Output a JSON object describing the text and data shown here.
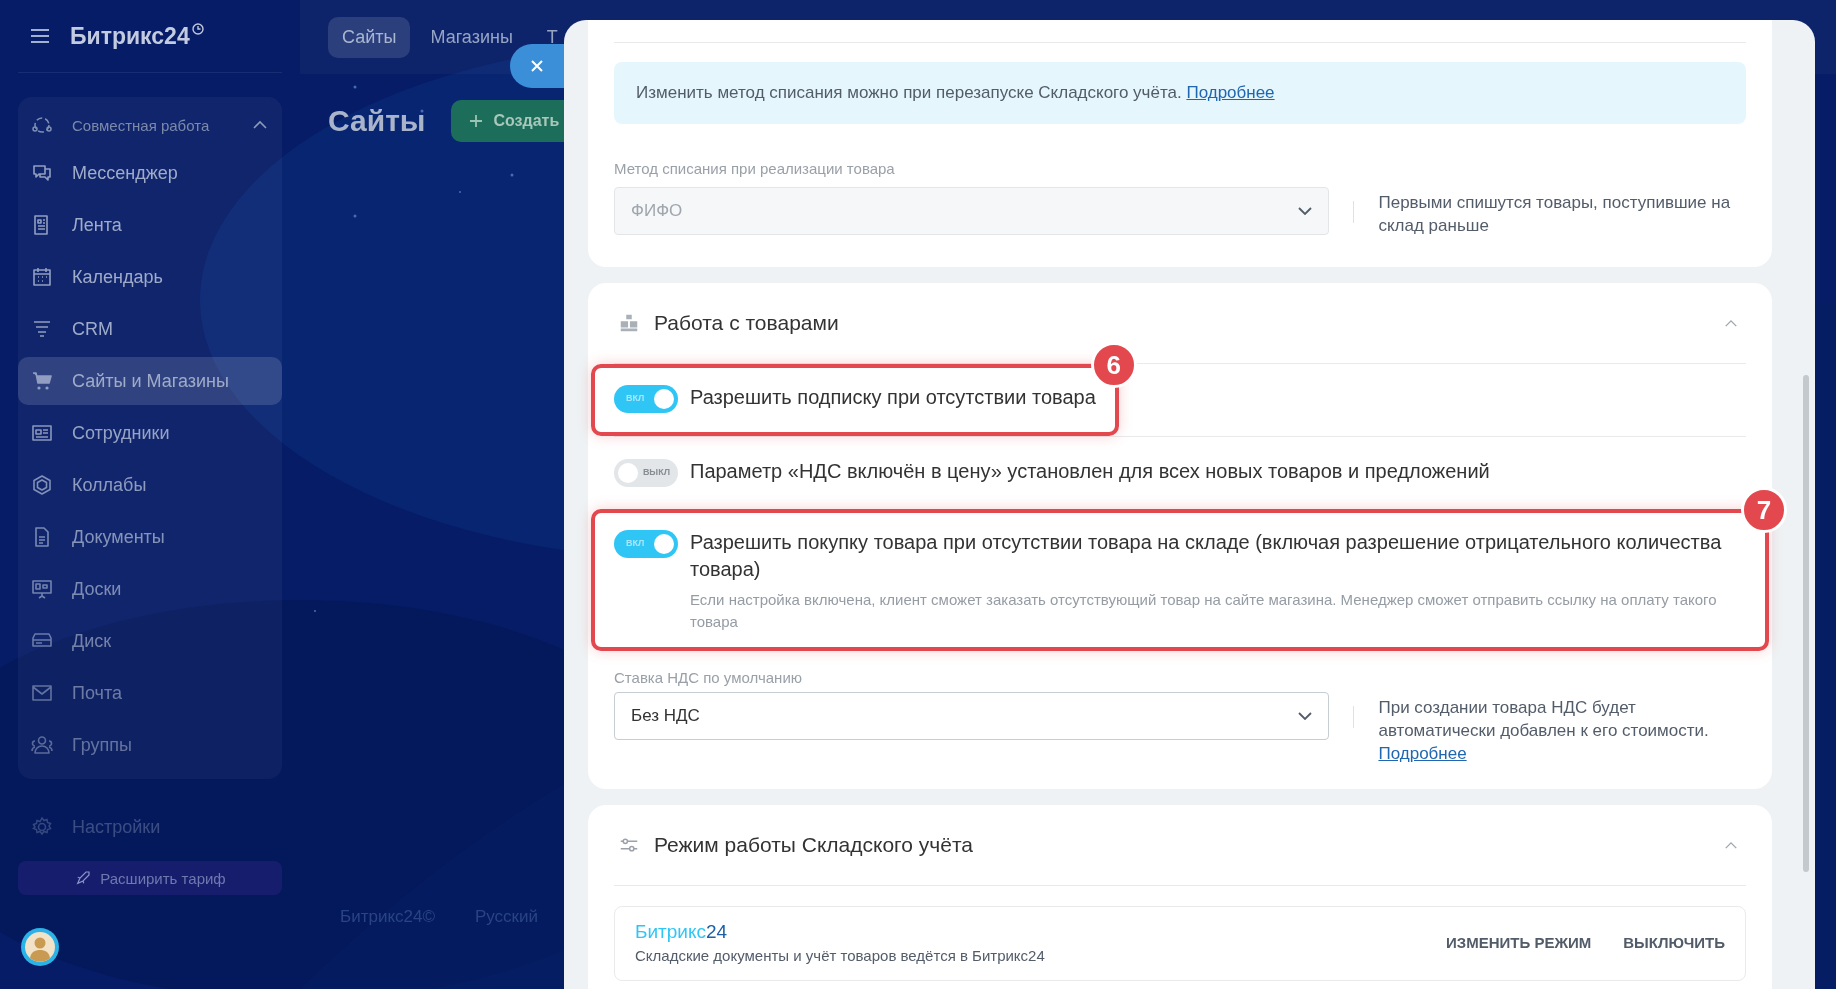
{
  "sidebar": {
    "logo": "Битрикс24",
    "group": {
      "label": "Совместная работа",
      "expanded": true
    },
    "items": [
      {
        "label": "Мессенджер",
        "selected": false
      },
      {
        "label": "Лента",
        "selected": false
      },
      {
        "label": "Календарь",
        "selected": false
      },
      {
        "label": "CRM",
        "selected": false
      },
      {
        "label": "Сайты и Магазины",
        "selected": true
      },
      {
        "label": "Сотрудники",
        "selected": false
      },
      {
        "label": "Коллабы",
        "selected": false
      },
      {
        "label": "Документы",
        "selected": false
      },
      {
        "label": "Доски",
        "selected": false
      },
      {
        "label": "Диск",
        "selected": false
      },
      {
        "label": "Почта",
        "selected": false
      },
      {
        "label": "Группы",
        "selected": false
      }
    ],
    "settings": "Настройки",
    "upgrade_button": "Расширить тариф"
  },
  "top_tabs": [
    {
      "label": "Сайты",
      "selected": true
    },
    {
      "label": "Магазины",
      "selected": false
    },
    {
      "label": "Т",
      "selected": false
    }
  ],
  "page_title": "Сайты",
  "create_button": "Создать",
  "footer": [
    "Битрикс24©",
    "Русский"
  ],
  "panel": {
    "cards": [
      {
        "kind": "method",
        "info": {
          "text": "Изменить метод списания можно при перезапуске Складского учёта.",
          "link": "Подробнее"
        },
        "select": {
          "label": "Метод списания при реализации товара",
          "value": "ФИФО",
          "disabled": true,
          "hint": "Первыми спишутся товары, поступившие на склад раньше"
        }
      },
      {
        "kind": "products",
        "title": "Работа с товарами",
        "expanded": true,
        "toggles": [
          {
            "label": "Разрешить подписку при отсутствии товара",
            "on": true,
            "switch_text": "ВКЛ",
            "highlight": "6"
          },
          {
            "label": "Параметр «НДС включён в цену» установлен для всех новых товаров и предложений",
            "on": false,
            "switch_text": "ВЫКЛ"
          },
          {
            "label": "Разрешить покупку товара при отсутствии товара на складе (включая разрешение отрицательного количества товара)",
            "on": true,
            "switch_text": "ВКЛ",
            "description": "Если настройка включена, клиент сможет заказать отсутствующий товар на сайте магазина. Менеджер сможет отправить ссылку на оплату такого товара",
            "highlight": "7"
          }
        ],
        "select": {
          "label": "Ставка НДС по умолчанию",
          "value": "Без НДС",
          "disabled": false,
          "hint": "При создании товара НДС будет автоматически добавлен к его стоимости.",
          "link": "Подробнее"
        }
      },
      {
        "kind": "mode",
        "title": "Режим работы Складского учёта",
        "expanded": true,
        "mode": {
          "name_main": "Битрикс",
          "name_suffix": "24",
          "description": "Складские документы и учёт товаров ведётся в Битрикс24",
          "buttons": [
            "ИЗМЕНИТЬ РЕЖИМ",
            "ВЫКЛЮЧИТЬ"
          ]
        }
      }
    ]
  }
}
